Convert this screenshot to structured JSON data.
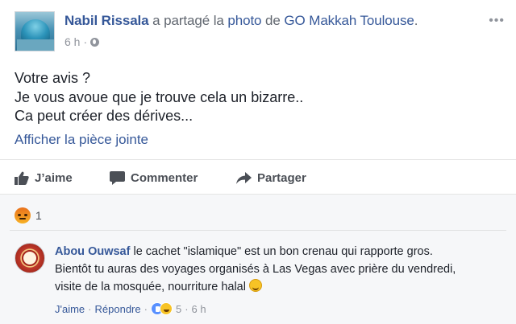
{
  "post": {
    "author": "Nabil Rissala",
    "shared_text": "a partagé la",
    "photo_link": "photo",
    "of_text": "de",
    "page_name": "GO Makkah Toulouse",
    "period": ".",
    "time": "6 h",
    "time_sep": "·",
    "privacy_icon": "globe-icon",
    "more_label": "•••",
    "text_lines": [
      "Votre avis ?",
      "Je vous avoue que je trouve cela un bizarre..",
      "Ca peut créer des dérives..."
    ],
    "attachment_link": "Afficher la pièce jointe"
  },
  "actions": {
    "like_label": "J’aime",
    "comment_label": "Commenter",
    "share_label": "Partager"
  },
  "reactions": {
    "type": "angry",
    "count": "1"
  },
  "comment": {
    "author": "Abou Ouwsaf",
    "lines": [
      "le cachet \"islamique\" est un bon crenau qui rapporte gros.",
      "Bientôt tu auras des voyages organisés à Las Vegas avec prière du vendredi,",
      "visite de la mosquée, nourriture halal"
    ],
    "like_label": "J'aime",
    "reply_label": "Répondre",
    "dot": "·",
    "reaction_count": "5",
    "time": "6 h"
  },
  "colors": {
    "link": "#365899",
    "muted": "#90949c",
    "text": "#1d2129",
    "comments_bg": "#f6f7f9"
  }
}
